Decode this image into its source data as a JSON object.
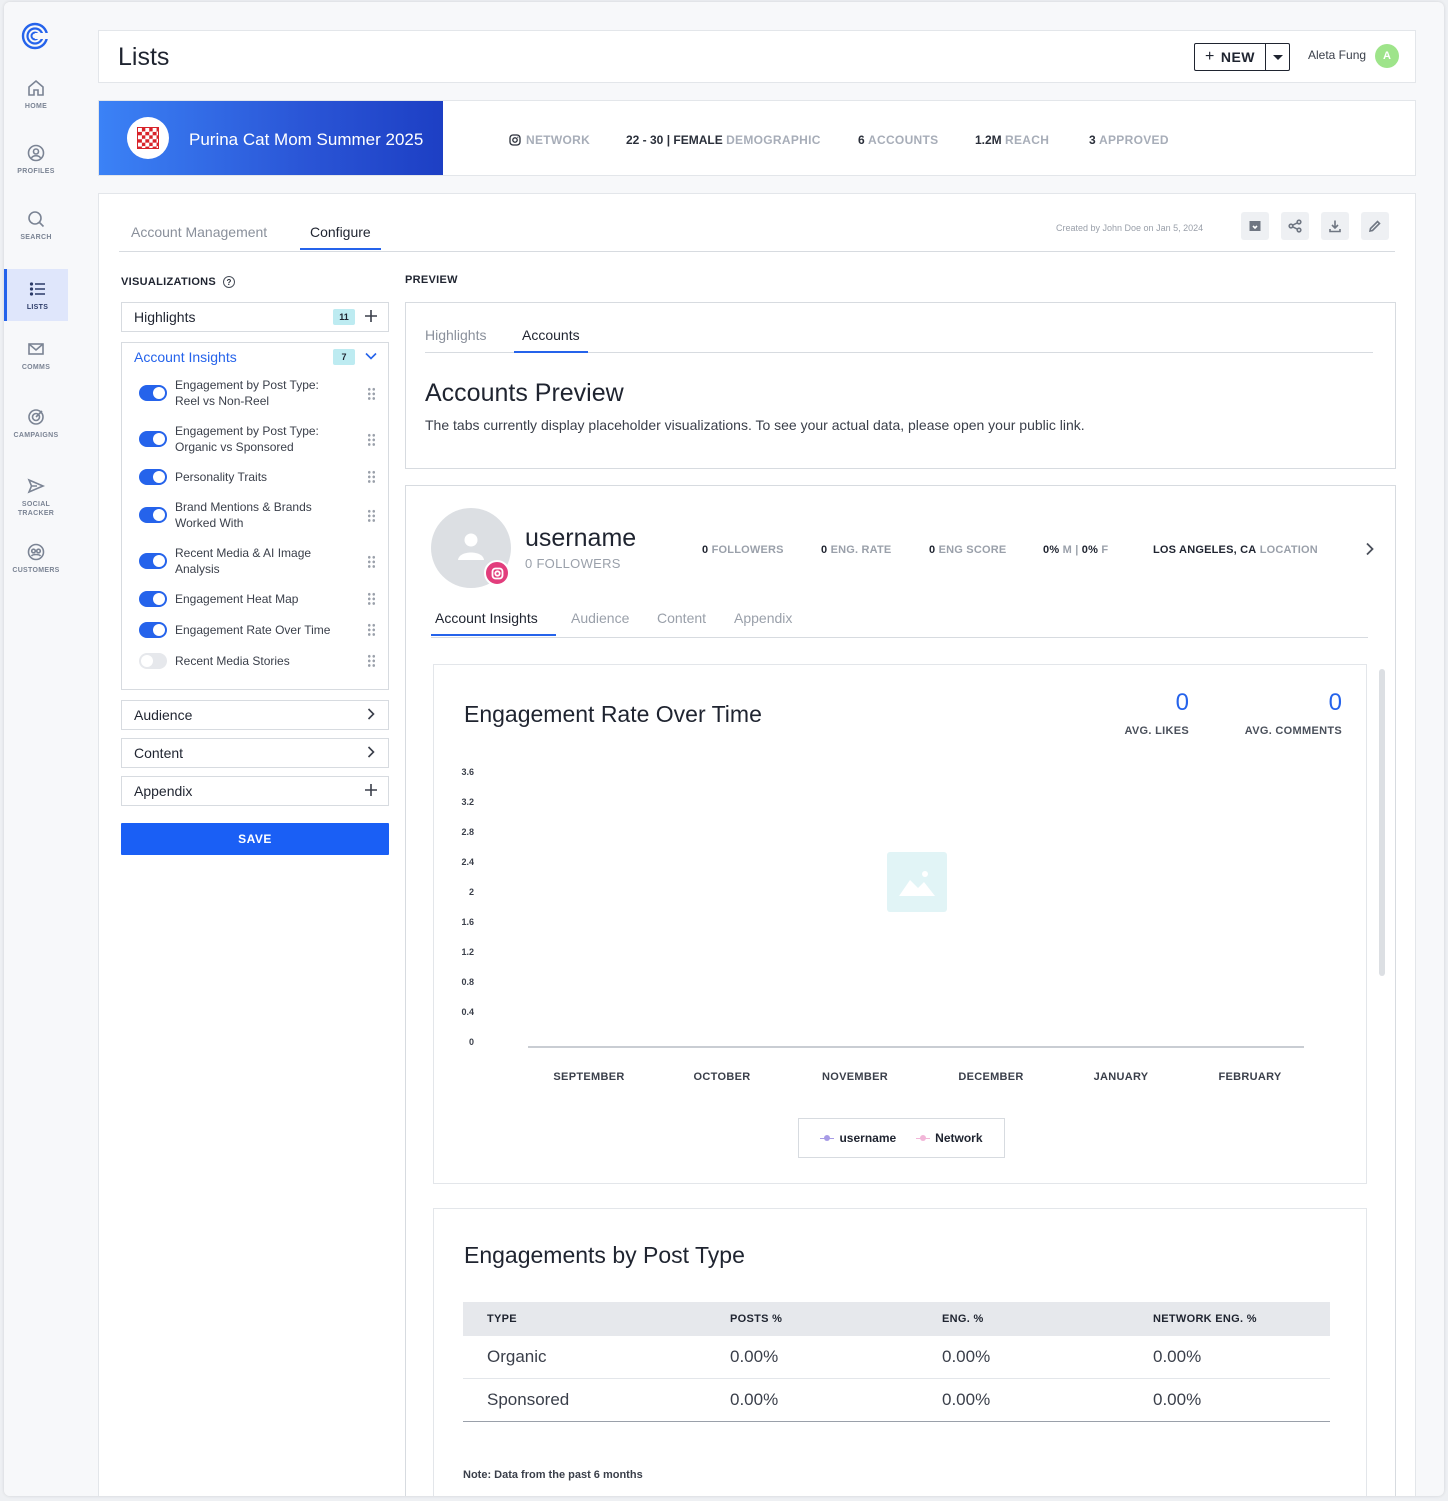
{
  "nav": {
    "items": [
      {
        "label": "HOME",
        "icon": "home-icon"
      },
      {
        "label": "PROFILES",
        "icon": "profile-icon"
      },
      {
        "label": "SEARCH",
        "icon": "search-icon"
      },
      {
        "label": "LISTS",
        "icon": "list-icon",
        "active": true
      },
      {
        "label": "COMMS",
        "icon": "mail-icon"
      },
      {
        "label": "CAMPAIGNS",
        "icon": "target-icon"
      },
      {
        "label": "SOCIAL TRACKER",
        "icon": "send-icon"
      },
      {
        "label": "CUSTOMERS",
        "icon": "customers-icon"
      }
    ]
  },
  "header": {
    "title": "Lists",
    "new_label": "NEW",
    "user_name": "Aleta Fung",
    "user_initial": "A"
  },
  "campaign": {
    "name": "Purina Cat Mom Summer 2025",
    "network_label": "NETWORK",
    "demographic_value": "22 - 30 | FEMALE",
    "demographic_label": "DEMOGRAPHIC",
    "accounts_value": "6",
    "accounts_label": "ACCOUNTS",
    "reach_value": "1.2M",
    "reach_label": "REACH",
    "approved_value": "3",
    "approved_label": "APPROVED"
  },
  "tabs": {
    "account_management": "Account Management",
    "configure": "Configure",
    "created": "Created by John Doe on Jan 5, 2024"
  },
  "visualizations": {
    "title": "VISUALIZATIONS",
    "highlights": {
      "label": "Highlights",
      "count": "11"
    },
    "account_insights": {
      "label": "Account Insights",
      "count": "7",
      "items": [
        {
          "label": "Engagement by Post Type: Reel vs Non-Reel",
          "on": true
        },
        {
          "label": "Engagement by Post Type: Organic vs Sponsored",
          "on": true
        },
        {
          "label": "Personality Traits",
          "on": true
        },
        {
          "label": "Brand Mentions & Brands Worked With",
          "on": true
        },
        {
          "label": "Recent Media & AI Image Analysis",
          "on": true
        },
        {
          "label": "Engagement Heat Map",
          "on": true
        },
        {
          "label": "Engagement Rate Over Time",
          "on": true
        },
        {
          "label": "Recent Media Stories",
          "on": false
        }
      ]
    },
    "audience": "Audience",
    "content": "Content",
    "appendix": "Appendix",
    "save": "SAVE"
  },
  "preview": {
    "title": "PREVIEW",
    "tab_highlights": "Highlights",
    "tab_accounts": "Accounts",
    "heading": "Accounts Preview",
    "description": "The tabs currently display placeholder visualizations. To see your actual data, please open your public link."
  },
  "profile": {
    "username": "username",
    "followers_line": "0 FOLLOWERS",
    "followers_value": "0",
    "followers_label": "FOLLOWERS",
    "eng_rate_value": "0",
    "eng_rate_label": "ENG. RATE",
    "eng_score_value": "0",
    "eng_score_label": "ENG SCORE",
    "male_value": "0%",
    "male_label": "M",
    "female_value": "0%",
    "female_label": "F",
    "location_value": "LOS ANGELES, CA",
    "location_label": "LOCATION",
    "tabs": [
      "Account Insights",
      "Audience",
      "Content",
      "Appendix"
    ]
  },
  "engagement_chart": {
    "title": "Engagement Rate Over Time",
    "avg_likes_value": "0",
    "avg_likes_label": "AVG. LIKES",
    "avg_comments_value": "0",
    "avg_comments_label": "AVG. COMMENTS",
    "legend": [
      "username",
      "Network"
    ],
    "colors": {
      "username": "#a79be6",
      "network": "#f2b6d8"
    }
  },
  "chart_data": {
    "type": "line",
    "title": "Engagement Rate Over Time",
    "categories": [
      "SEPTEMBER",
      "OCTOBER",
      "NOVEMBER",
      "DECEMBER",
      "JANUARY",
      "FEBRUARY"
    ],
    "yticks": [
      "3.6",
      "3.2",
      "2.8",
      "2.4",
      "2",
      "1.6",
      "1.2",
      "0.8",
      "0.4",
      "0"
    ],
    "ylim": [
      0,
      3.6
    ],
    "series": [
      {
        "name": "username",
        "values": []
      },
      {
        "name": "Network",
        "values": []
      }
    ],
    "legend": "bottom-center",
    "grid": false
  },
  "post_type": {
    "title": "Engagements by Post Type",
    "headers": [
      "TYPE",
      "POSTS %",
      "ENG. %",
      "NETWORK ENG. %"
    ],
    "rows": [
      [
        "Organic",
        "0.00%",
        "0.00%",
        "0.00%"
      ],
      [
        "Sponsored",
        "0.00%",
        "0.00%",
        "0.00%"
      ]
    ],
    "note": "Note: Data from the past 6 months"
  }
}
